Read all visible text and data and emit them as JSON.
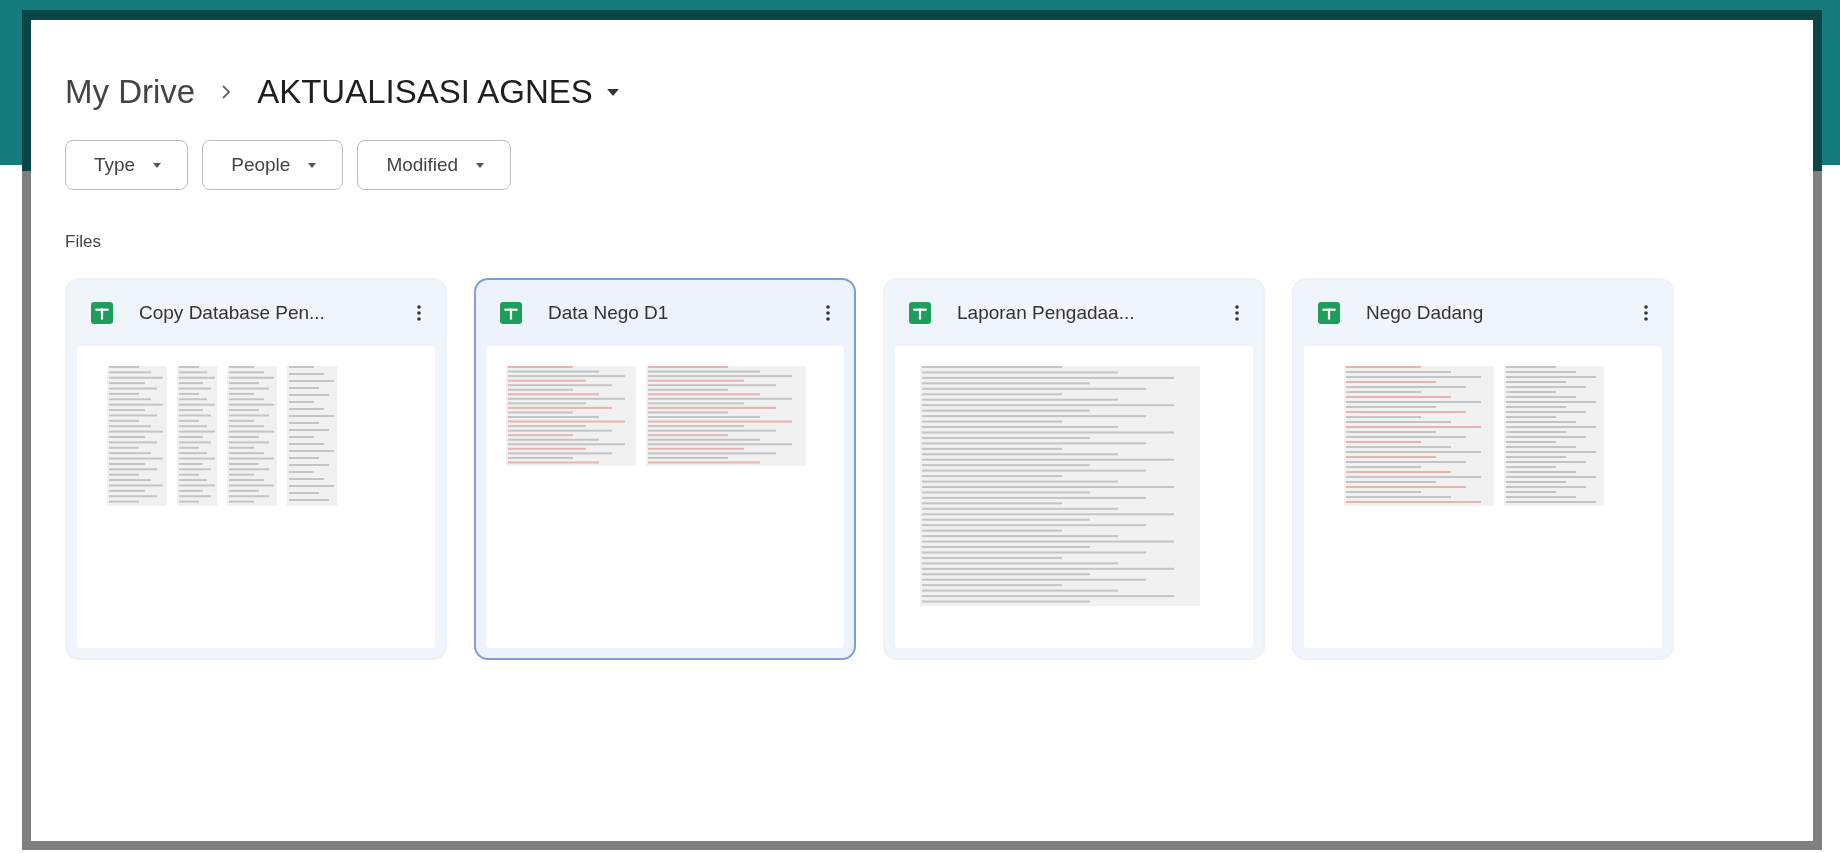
{
  "breadcrumb": [
    {
      "label": "My Drive",
      "current": false
    },
    {
      "label": "AKTUALISASI AGNES",
      "current": true
    }
  ],
  "filters": [
    {
      "label": "Type"
    },
    {
      "label": "People"
    },
    {
      "label": "Modified"
    }
  ],
  "section_title": "Files",
  "files": [
    {
      "name": "Copy Database Pen...",
      "selected": false,
      "kind": "picture"
    },
    {
      "name": "Data Nego D1",
      "selected": true,
      "kind": "picture"
    },
    {
      "name": "Laporan Pengadaa...",
      "selected": false,
      "kind": "picture"
    },
    {
      "name": "Nego Dadang",
      "selected": false,
      "kind": "picture"
    }
  ]
}
